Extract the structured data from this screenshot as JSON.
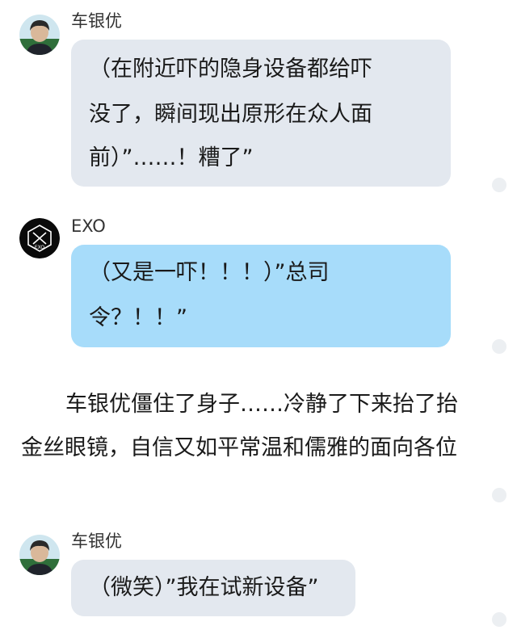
{
  "messages": [
    {
      "sender": "车银优",
      "avatar_icon": "profile-photo-icon",
      "bubble_color": "#e3e8ef",
      "lines": [
        "（在附近吓的隐身设备都给吓",
        "没了，瞬间现出原形在众人面",
        "前）”……！糟了”"
      ]
    },
    {
      "sender": "EXO",
      "avatar_icon": "exo-logo-icon",
      "bubble_color": "#a7dcfa",
      "lines": [
        "（又是一吓！！！）”总司",
        "令？！！”"
      ]
    },
    {
      "sender": "车银优",
      "avatar_icon": "profile-photo-icon",
      "bubble_color": "#e3e8ef",
      "lines": [
        "（微笑）”我在试新设备”"
      ]
    }
  ],
  "narration": {
    "lines": [
      "车银优僵住了身子……冷静了下来抬了抬",
      "金丝眼镜，自信又如平常温和儒雅的面向各位"
    ]
  },
  "avatar_logo_text": "EXO"
}
